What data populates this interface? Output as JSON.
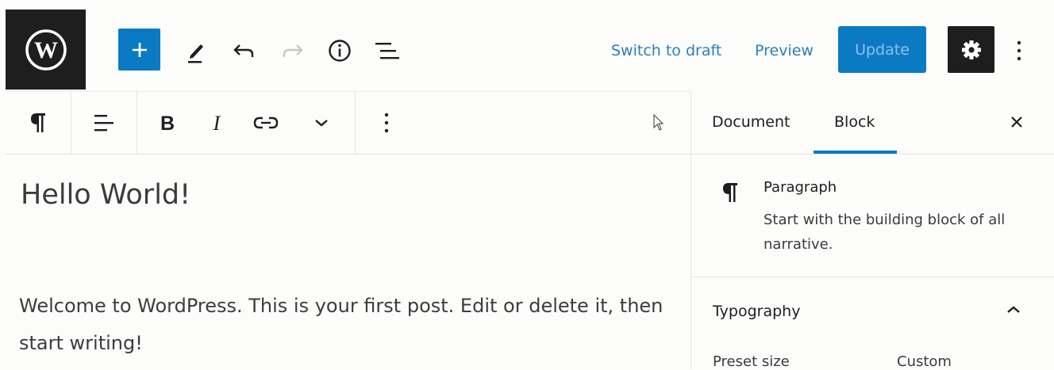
{
  "header": {
    "logo_icon": "wordpress-logo-icon",
    "tools": [
      {
        "name": "add-block",
        "icon": "plus-icon"
      },
      {
        "name": "tools",
        "icon": "pencil-icon"
      },
      {
        "name": "undo",
        "icon": "undo-icon"
      },
      {
        "name": "redo",
        "icon": "redo-icon"
      },
      {
        "name": "details",
        "icon": "info-icon"
      },
      {
        "name": "block-navigation",
        "icon": "list-view-icon"
      }
    ],
    "switch_to_draft": "Switch to draft",
    "preview": "Preview",
    "update": "Update",
    "settings_icon": "gear-icon",
    "more_icon": "kebab-icon"
  },
  "block_toolbar": {
    "items": [
      "paragraph-icon",
      "align-left-icon",
      "bold-icon",
      "italic-icon",
      "link-icon",
      "chevron-down-icon",
      "kebab-icon"
    ]
  },
  "editor": {
    "title": "Hello World!",
    "paragraph": "Welcome to WordPress. This is your first post. Edit or delete it, then start writing!"
  },
  "sidebar": {
    "tabs": [
      {
        "label": "Document",
        "active": false
      },
      {
        "label": "Block",
        "active": true
      }
    ],
    "block_card": {
      "icon": "paragraph-icon",
      "title": "Paragraph",
      "description": "Start with the building block of all narrative."
    },
    "typography": {
      "title": "Typography",
      "preset_size_label": "Preset size",
      "custom_label": "Custom"
    }
  },
  "colors": {
    "accent": "#0a7ac3",
    "dark": "#1e1e1e",
    "link": "#2a7fc1",
    "background": "#fcfcfb"
  }
}
